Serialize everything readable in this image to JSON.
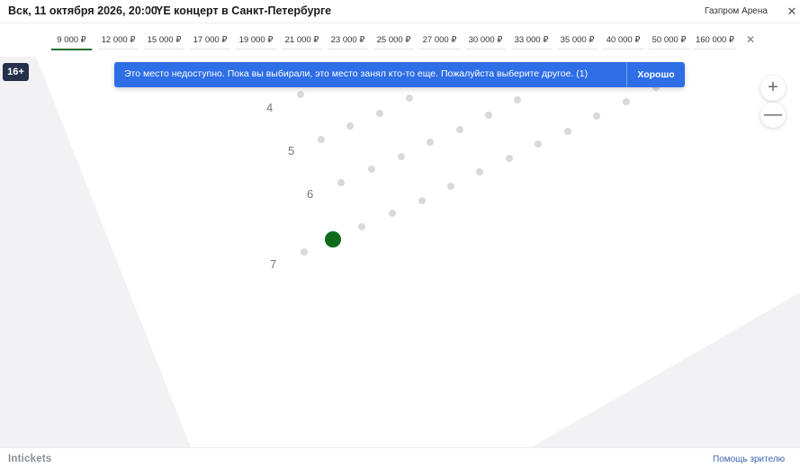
{
  "header": {
    "date": "Вск, 11 октября 2026, 20:00",
    "separator": "•",
    "event": "YE концерт в Санкт-Петербурге",
    "venue": "Газпром Арена",
    "close_label": "✕"
  },
  "prices": {
    "items": [
      "9 000 ₽",
      "12 000 ₽",
      "15 000 ₽",
      "17 000 ₽",
      "19 000 ₽",
      "21 000 ₽",
      "23 000 ₽",
      "25 000 ₽",
      "27 000 ₽",
      "30 000 ₽",
      "33 000 ₽",
      "35 000 ₽",
      "40 000 ₽",
      "50 000 ₽",
      "160 000 ₽"
    ],
    "selected": "9 000 ₽",
    "close_label": "✕"
  },
  "age_rating": "16+",
  "notification": {
    "message": "Это место недоступно. Пока вы выбирали, это место занял кто-то еще. Пожалуйста выберите другое. (1)",
    "button": "Хорошо",
    "color": "#2e6ee6"
  },
  "zoom": {
    "in_label": "+",
    "out_label": "—"
  },
  "map": {
    "row_labels": [
      "4",
      "5",
      "6",
      "7"
    ],
    "seat_color": "#d9d9d9",
    "selected_seat_color": "#0d6b1a",
    "section_color": "#f2f2f4"
  },
  "footer": {
    "logo": "Intickets",
    "help": "Помощь зрителю"
  }
}
